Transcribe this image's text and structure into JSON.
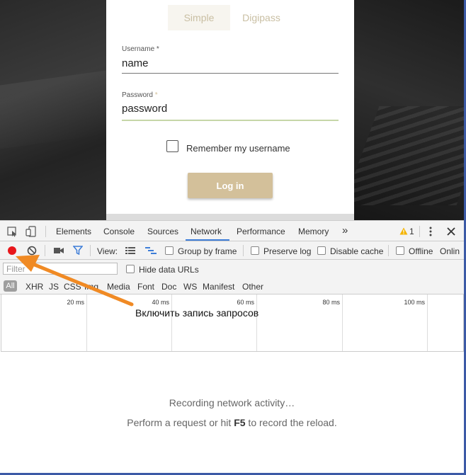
{
  "login": {
    "tabs": [
      "Simple",
      "Digipass"
    ],
    "username_label": "Username",
    "username_value": "name",
    "password_label": "Password",
    "password_value": "password",
    "required_mark": "*",
    "remember_label": "Remember my username",
    "login_button": "Log in"
  },
  "devtools": {
    "tabs": [
      "Elements",
      "Console",
      "Sources",
      "Network",
      "Performance",
      "Memory"
    ],
    "more_tabs": "»",
    "warning_count": "1",
    "toolbar": {
      "view_label": "View:",
      "group_by_frame": "Group by frame",
      "preserve_log": "Preserve log",
      "disable_cache": "Disable cache",
      "offline": "Offline",
      "online": "Onlin"
    },
    "filter_placeholder": "Filter",
    "hide_data_urls": "Hide data URLs",
    "types": [
      "All",
      "XHR",
      "JS",
      "CSS",
      "Img",
      "Media",
      "Font",
      "Doc",
      "WS",
      "Manifest",
      "Other"
    ],
    "timeline_ticks": [
      "20 ms",
      "40 ms",
      "60 ms",
      "80 ms",
      "100 ms"
    ],
    "recording_msg": "Recording network activity…",
    "reload_msg_prefix": "Perform a request or hit ",
    "reload_msg_key": "F5",
    "reload_msg_suffix": " to record the reload."
  },
  "annotation": {
    "text": "Включить запись запросов",
    "color": "#f08a24"
  },
  "colors": {
    "accent_gold": "#d3c09a",
    "record_red": "#e8161b",
    "devtools_blue": "#3d7dd8",
    "border_blue": "#3c5aa6"
  }
}
